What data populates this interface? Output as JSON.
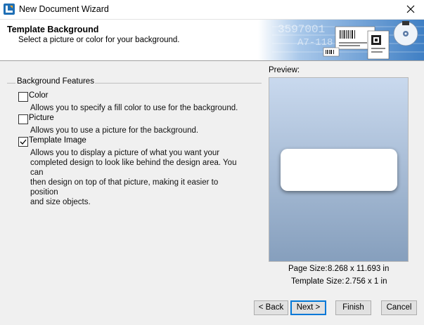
{
  "window": {
    "title": "New Document Wizard"
  },
  "header": {
    "title": "Template Background",
    "subtitle": "Select a picture or color for your background.",
    "art_text_1": "3597001",
    "art_text_2": "A7-118"
  },
  "group": {
    "label": "Background Features"
  },
  "options": [
    {
      "label": "Color",
      "checked": false,
      "description": [
        "Allows you to specify a fill color to use for the background."
      ]
    },
    {
      "label": "Picture",
      "checked": false,
      "description": [
        "Allows you to use a picture for the background."
      ]
    },
    {
      "label": "Template Image",
      "checked": true,
      "description": [
        "Allows you to display a picture of what you want your",
        "completed design to look like behind the design area. You can",
        "then design on top of that picture, making it easier to position",
        "and size objects."
      ]
    }
  ],
  "preview": {
    "label": "Preview:",
    "page_size_label": "Page Size:",
    "page_size_value": "8.268 x 11.693 in",
    "template_size_label": "Template Size:",
    "template_size_value": "2.756 x 1 in"
  },
  "buttons": {
    "back": "< Back",
    "next": "Next >",
    "finish": "Finish",
    "cancel": "Cancel"
  },
  "colors": {
    "accent": "#0078d7",
    "preview_top": "#c9d9ee",
    "preview_bottom": "#869fbd"
  }
}
